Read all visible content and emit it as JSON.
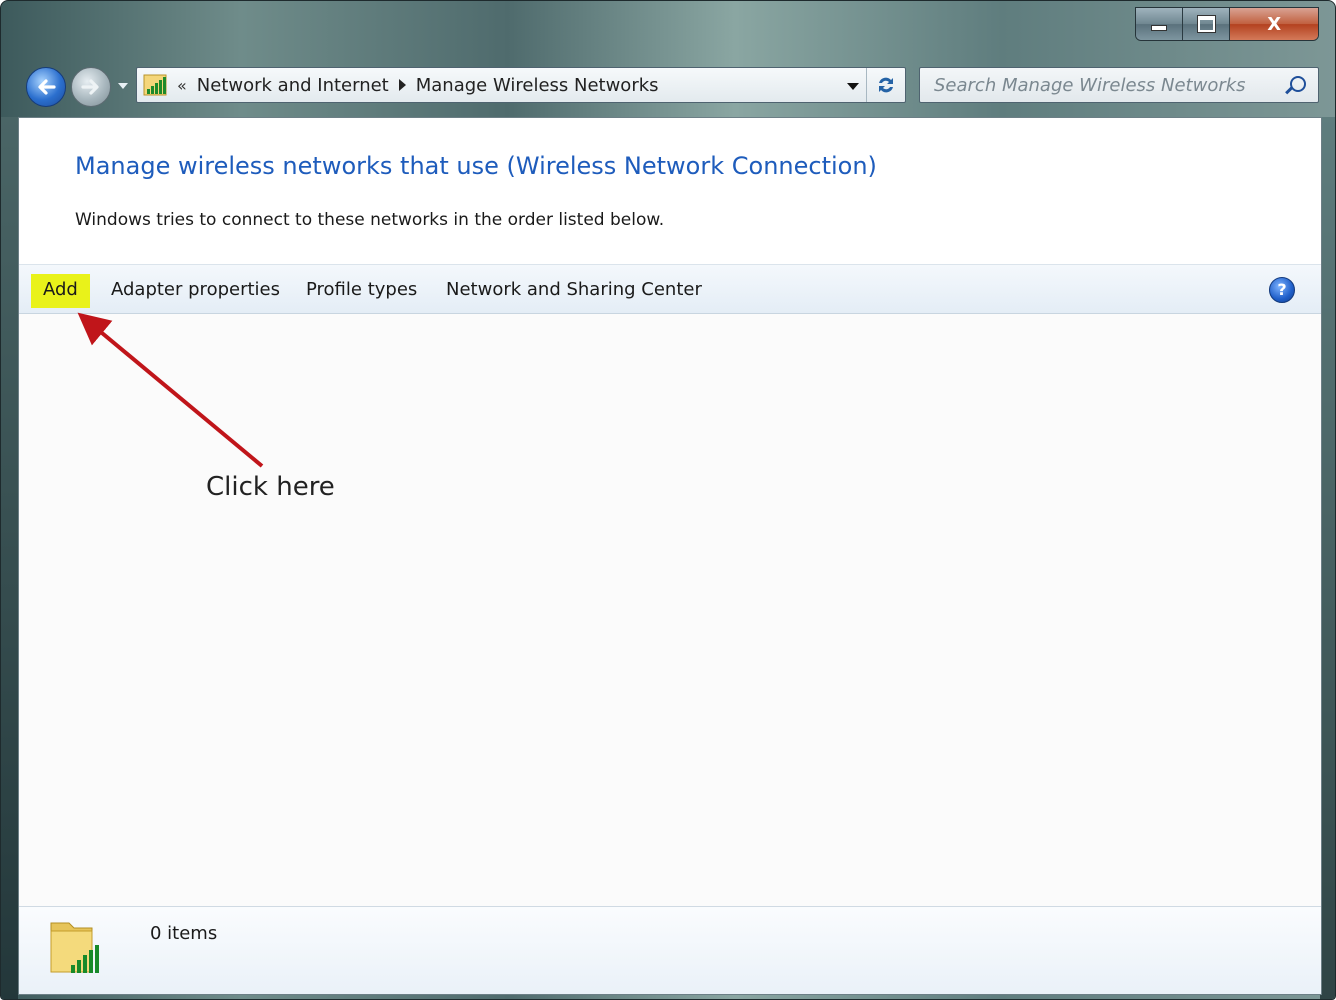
{
  "window": {
    "caption": {
      "minimize": "minimize",
      "maximize": "maximize",
      "close": "X"
    }
  },
  "nav": {
    "breadcrumb_sep": "«",
    "breadcrumb": [
      "Network and Internet",
      "Manage Wireless Networks"
    ],
    "search_placeholder": "Search Manage Wireless Networks"
  },
  "header": {
    "title": "Manage wireless networks that use (Wireless Network Connection)",
    "subtitle": "Windows tries to connect to these networks in the order listed below."
  },
  "toolbar": {
    "items": [
      "Add",
      "Adapter properties",
      "Profile types",
      "Network and Sharing Center"
    ],
    "help": "?"
  },
  "annotation": {
    "label": "Click here",
    "color": "#c0151a"
  },
  "status": {
    "count_text": "0 items"
  },
  "colors": {
    "title": "#1e5cbc",
    "highlight": "#e9f21a",
    "arrow": "#c0151a"
  }
}
